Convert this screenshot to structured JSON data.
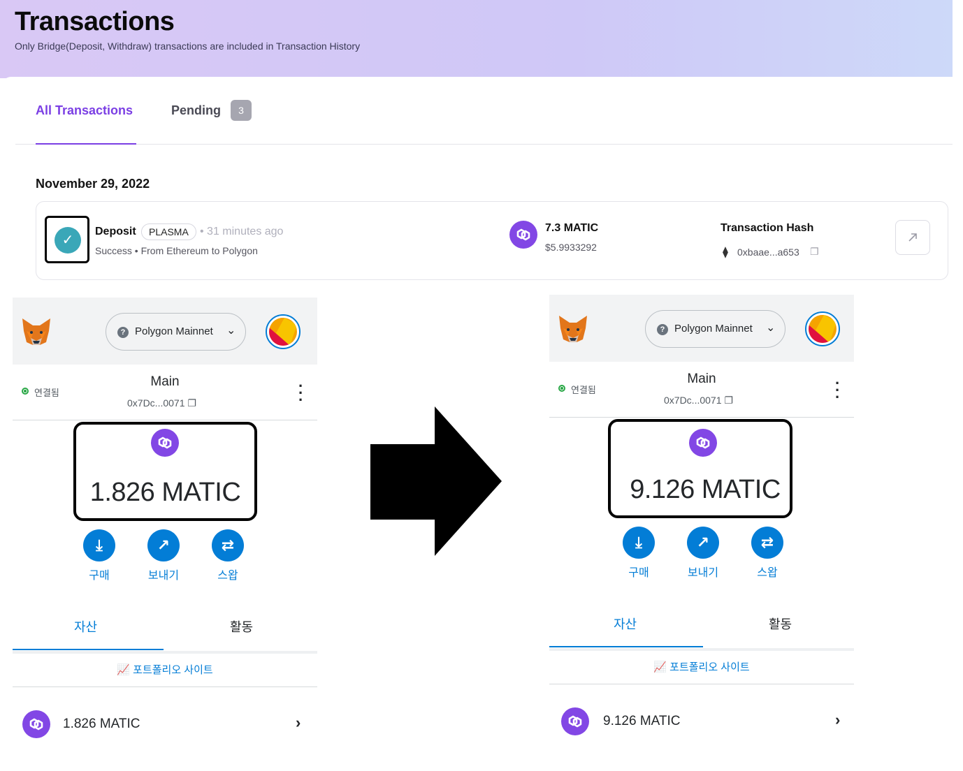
{
  "transactions": {
    "title": "Transactions",
    "subtitle": "Only Bridge(Deposit, Withdraw) transactions are included in Transaction History",
    "tabs": {
      "all": "All Transactions",
      "pending": "Pending",
      "pending_count": "3"
    },
    "date": "November 29, 2022",
    "row": {
      "status_icon": "check-icon",
      "type": "Deposit",
      "chip": "PLASMA",
      "time": "• 31 minutes ago",
      "status": "Success • From Ethereum to Polygon",
      "amount": "7.3 MATIC",
      "amount_usd": "$5.9933292",
      "hash_label": "Transaction Hash",
      "hash_value": "0xbaae...a653"
    },
    "accent": "#7b3fe4"
  },
  "wallet_before": {
    "network": "Polygon Mainnet",
    "connected": "연결됨",
    "account": "Main",
    "address": "0x7Dc...0071",
    "balance": "1.826 MATIC",
    "actions": [
      "구매",
      "보내기",
      "스왑"
    ],
    "tabs": [
      "자산",
      "활동"
    ],
    "portfolio": "포트폴리오 사이트",
    "asset": "1.826 MATIC"
  },
  "wallet_after": {
    "network": "Polygon Mainnet",
    "connected": "연결됨",
    "account": "Main",
    "address": "0x7Dc...0071",
    "balance": "9.126 MATIC",
    "actions": [
      "구매",
      "보내기",
      "스왑"
    ],
    "tabs": [
      "자산",
      "활동"
    ],
    "portfolio": "포트폴리오 사이트",
    "asset": "9.126 MATIC"
  },
  "colors": {
    "metamask_blue": "#037dd6",
    "matic_purple": "#8247e5"
  }
}
